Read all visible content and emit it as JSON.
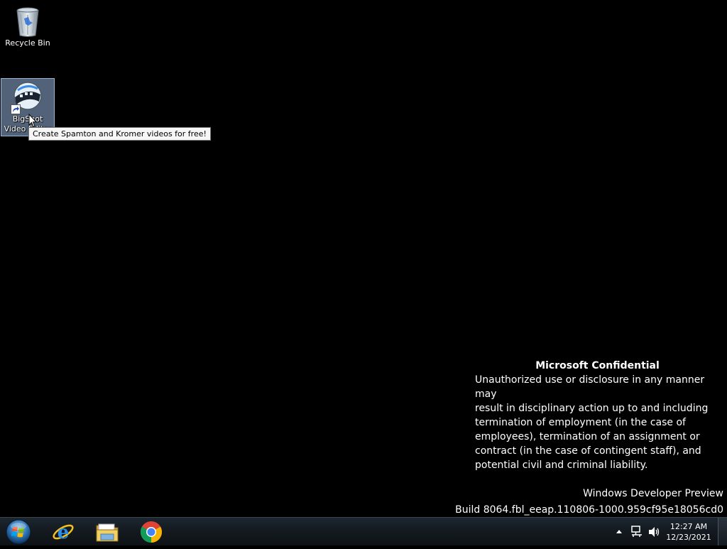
{
  "desktop": {
    "icons": [
      {
        "label": "Recycle Bin",
        "icon": "recycle-bin-icon"
      },
      {
        "label": "BigShot Video Editor",
        "icon": "video-editor-icon"
      }
    ],
    "tooltip": "Create Spamton and Kromer videos for free!"
  },
  "watermark": {
    "title": "Microsoft Confidential",
    "lines": [
      "Unauthorized use or disclosure in any manner may",
      "result in disciplinary action up to and including",
      "termination of employment (in the case of",
      "employees), termination of an assignment or",
      "contract (in the case of contingent staff), and",
      "potential civil and criminal liability."
    ],
    "product": "Windows Developer Preview",
    "build": "Build 8064.fbl_eeap.110806-1000.959cf95e18056cd0"
  },
  "taskbar": {
    "start_icon": "windows-start-icon",
    "pinned": [
      {
        "name": "Internet Explorer",
        "icon": "internet-explorer-icon"
      },
      {
        "name": "Windows Explorer",
        "icon": "folder-icon"
      },
      {
        "name": "Google Chrome",
        "icon": "chrome-icon"
      }
    ],
    "tray": {
      "time": "12:27 AM",
      "date": "12/23/2021"
    }
  },
  "colors": {
    "desktop_bg": "#000000",
    "selection": "#9ab4d8"
  }
}
